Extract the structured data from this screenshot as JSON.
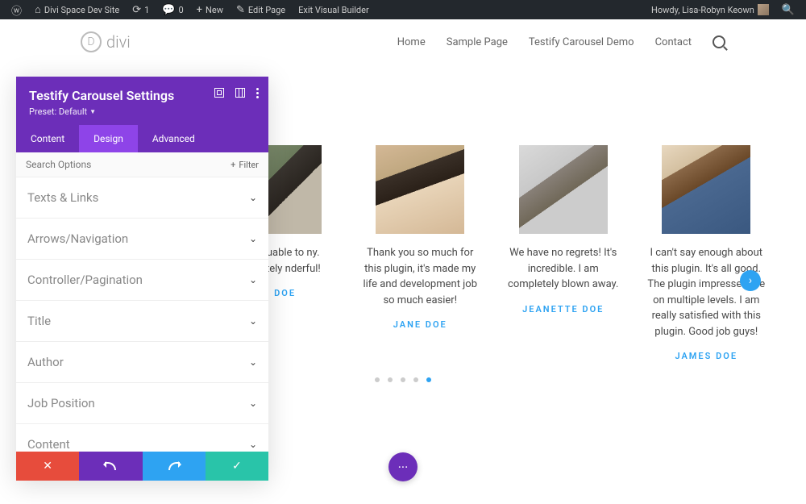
{
  "wp_bar": {
    "site_name": "Divi Space Dev Site",
    "updates": "1",
    "comments": "0",
    "new": "New",
    "edit": "Edit Page",
    "exit": "Exit Visual Builder",
    "howdy": "Howdy, Lisa-Robyn Keown"
  },
  "header": {
    "logo": "divi",
    "nav": [
      "Home",
      "Sample Page",
      "Testify Carousel Demo",
      "Contact"
    ]
  },
  "panel": {
    "title": "Testify Carousel Settings",
    "preset_label": "Preset: Default",
    "tabs": [
      "Content",
      "Design",
      "Advanced"
    ],
    "active_tab": 1,
    "search_placeholder": "Search Options",
    "filter_label": "Filter",
    "options": [
      "Texts & Links",
      "Arrows/Navigation",
      "Controller/Pagination",
      "Title",
      "Author",
      "Job Position",
      "Content"
    ]
  },
  "carousel": {
    "cards": [
      {
        "text": "is invaluable to ny. Absolutely nderful!",
        "author": "IN DOE"
      },
      {
        "text": "Thank you so much for this plugin, it's made my life and development job so much easier!",
        "author": "JANE DOE"
      },
      {
        "text": "We have no regrets! It's incredible. I am completely blown away.",
        "author": "JEANETTE DOE"
      },
      {
        "text": "I can't say enough about this plugin. It's all good. The plugin impressed me on multiple levels. I am really satisfied with this plugin. Good job guys!",
        "author": "JAMES DOE"
      }
    ],
    "dot_count": 5,
    "active_dot": 4
  }
}
